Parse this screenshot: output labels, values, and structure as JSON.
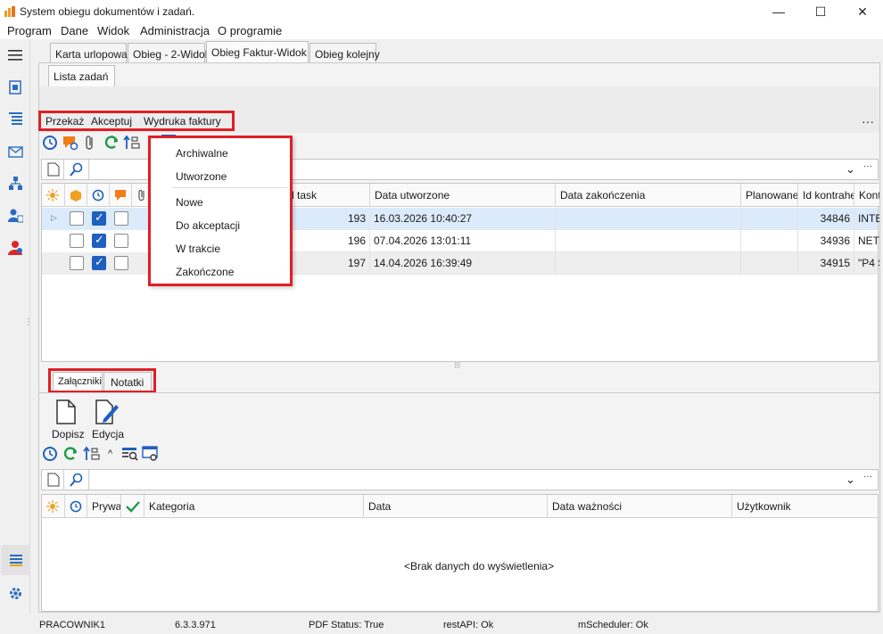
{
  "window": {
    "title": "System obiegu dokumentów i zadań.",
    "minimize": "—",
    "maximize": "☐",
    "close": "✕"
  },
  "menu": [
    "Program",
    "Dane",
    "Widok",
    "Administracja",
    "O programie"
  ],
  "top_tabs": [
    "Karta urlopowa",
    "Obieg - 2-Widok",
    "Obieg Faktur-Widok",
    "Obieg kolejny"
  ],
  "active_top_tab": "Obieg Faktur-Widok",
  "sub_tab": "Lista zadań",
  "actions": {
    "przekaz": "Przekaż",
    "akceptuj": "Akceptuj",
    "wydruka": "Wydruka faktury",
    "more": "···"
  },
  "dropdown": {
    "items": [
      "Archiwalne",
      "Utworzone",
      "Nowe",
      "Do akceptacji",
      "W trakcie",
      "Zakończone"
    ]
  },
  "filter": {
    "value": "",
    "ellipsis": "···"
  },
  "table": {
    "columns": [
      "d task",
      "Data utworzone",
      "Data zakończenia",
      "Planowane",
      "Id kontrahe",
      "Kont"
    ],
    "rows": [
      {
        "task": "193",
        "created": "16.03.2026 10:40:27",
        "ended": "",
        "planned": "",
        "contractor_id": "34846",
        "contractor": "INTE"
      },
      {
        "task": "196",
        "created": "07.04.2026 13:01:11",
        "ended": "",
        "planned": "",
        "contractor_id": "34936",
        "contractor": "NET"
      },
      {
        "task": "197",
        "created": "14.04.2026 16:39:49",
        "ended": "",
        "planned": "",
        "contractor_id": "34915",
        "contractor": "\"P4 S"
      }
    ]
  },
  "bottom_tabs": [
    "Załączniki",
    "Notatki"
  ],
  "bottom_buttons": {
    "dopisz": "Dopisz",
    "edycja": "Edycja",
    "caret": "^"
  },
  "notes_table": {
    "columns": [
      "Prywa",
      "Kategoria",
      "Data",
      "Data ważności",
      "Użytkownik"
    ],
    "empty": "<Brak danych do wyświetlenia>"
  },
  "status": {
    "user": "PRACOWNIK1",
    "version": "6.3.3.971",
    "pdf": "PDF Status: True",
    "rest": "restAPI: Ok",
    "scheduler": "mScheduler: Ok"
  },
  "colors": {
    "highlight": "#e01f26",
    "accent": "#1f5fbf",
    "selected_row": "#dcebfc"
  }
}
